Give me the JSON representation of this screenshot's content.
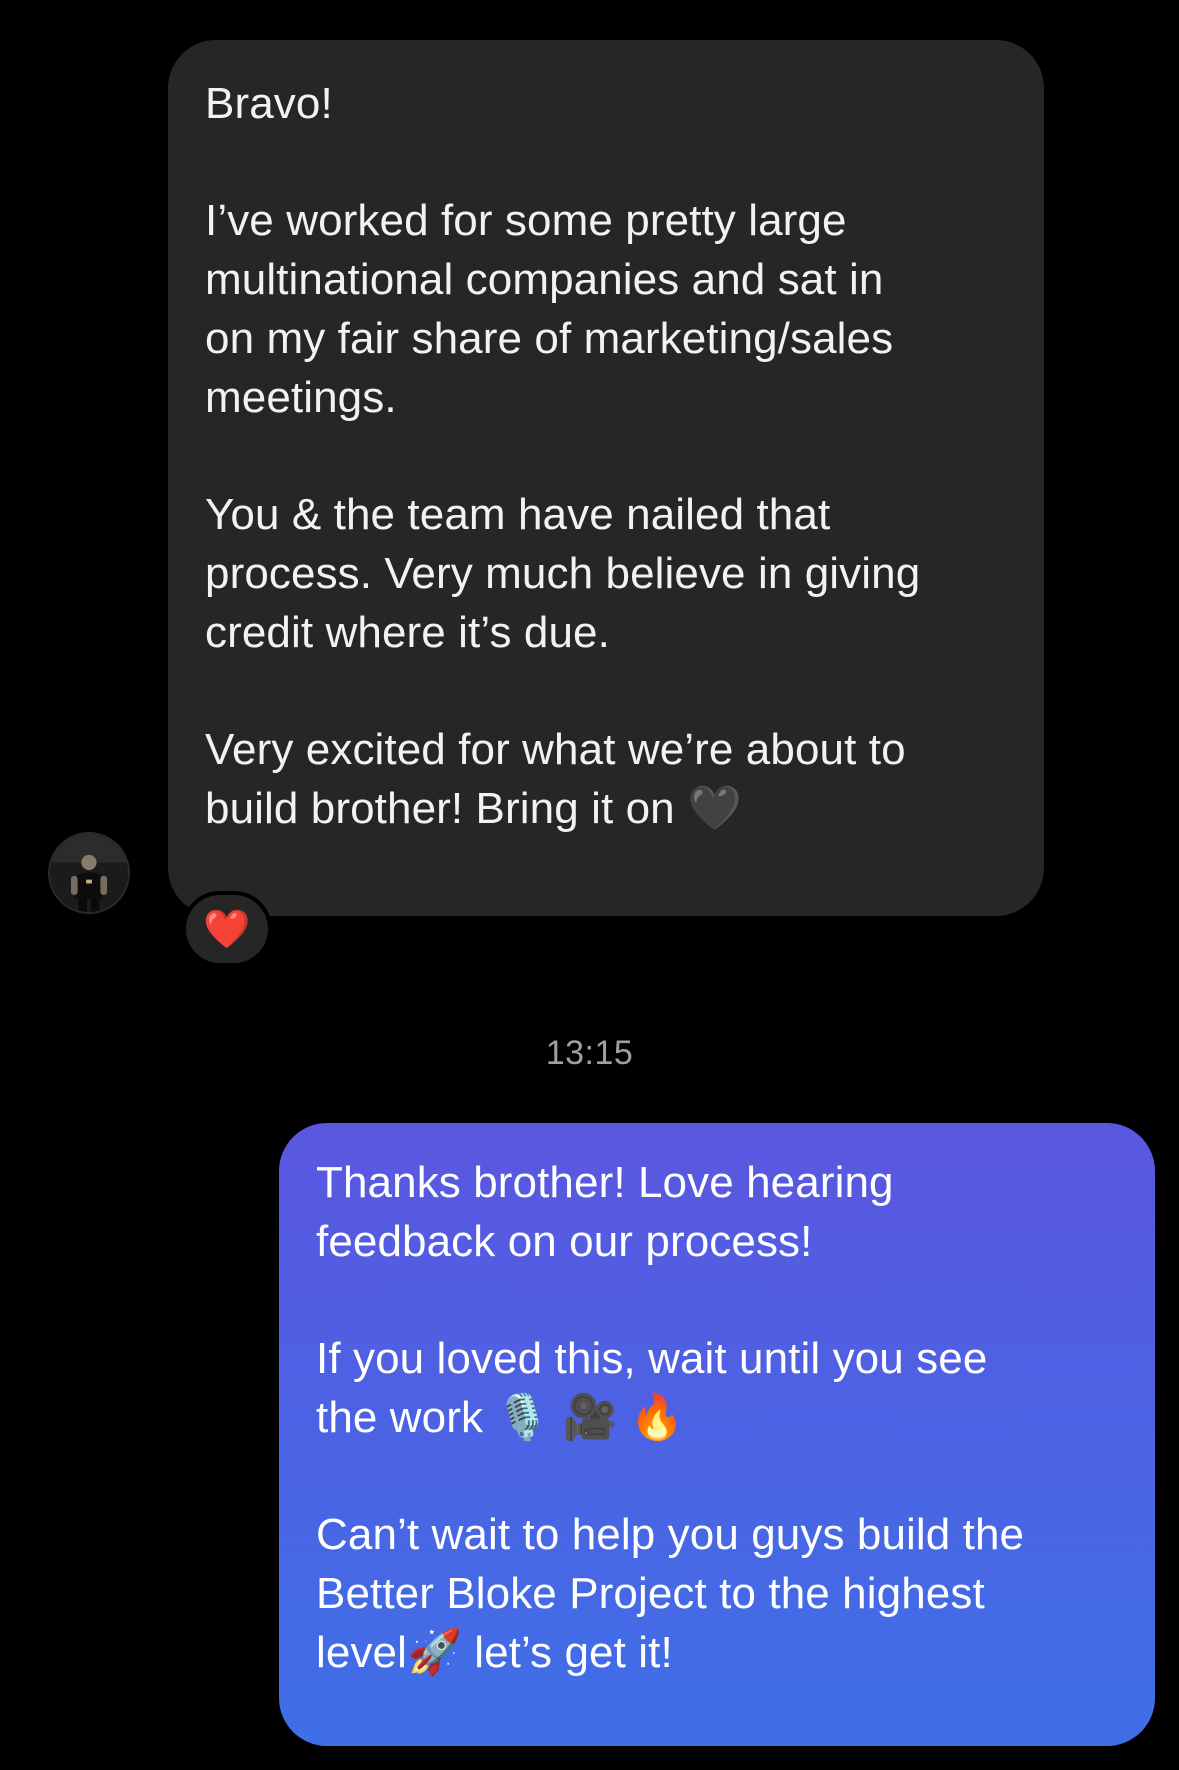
{
  "incoming_message": {
    "paragraphs": [
      "Bravo!",
      "I’ve worked for some pretty large\nmultinational companies and sat in\non my fair share of marketing/sales\nmeetings.",
      "You & the team have nailed that\nprocess. Very much believe in giving\ncredit where it’s due.",
      "Very excited for what we’re about to\nbuild brother! Bring it on 🖤"
    ],
    "reaction": "❤️",
    "bubble_color": "#262626"
  },
  "timestamp": "13:15",
  "outgoing_message": {
    "paragraphs": [
      "Thanks brother! Love hearing\nfeedback on our process!",
      "If you loved this, wait until you see\nthe work 🎙️ 🎥 🔥",
      "Can’t wait to help you guys build the\nBetter Bloke Project to the highest\nlevel🚀 let’s get it!"
    ],
    "bubble_color_top": "#5a57e0",
    "bubble_color_bottom": "#3f6fe6"
  },
  "avatar_icon": "profile-photo",
  "background_color": "#000000"
}
